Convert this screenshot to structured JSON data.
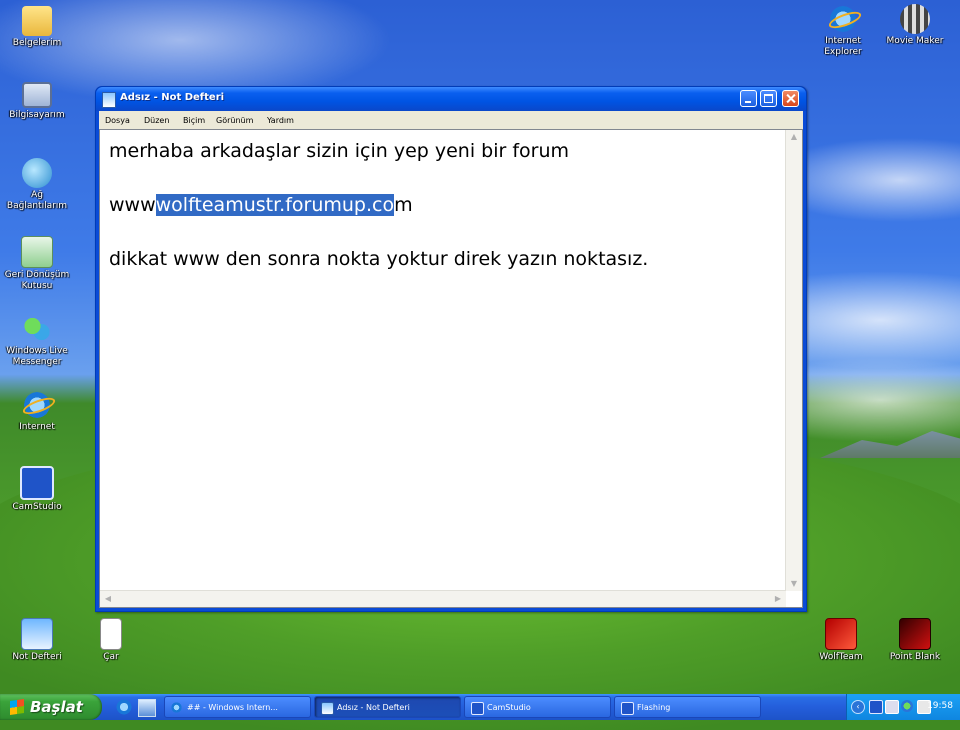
{
  "desktop": {
    "left_icons": [
      {
        "label": "Belgelerim",
        "icon": "folder-icon"
      },
      {
        "label": "Bilgisayarım",
        "icon": "computer-icon"
      },
      {
        "label": "Ağ Bağlantılarım",
        "icon": "network-icon"
      },
      {
        "label": "Geri Dönüşüm Kutusu",
        "icon": "recycle-bin-icon"
      },
      {
        "label": "Windows Live Messenger",
        "icon": "messenger-icon"
      },
      {
        "label": "Internet",
        "icon": "internet-explorer-icon"
      },
      {
        "label": "CamStudio",
        "icon": "camstudio-icon"
      }
    ],
    "bottom_left_icons": [
      {
        "label": "Not Defteri",
        "icon": "notepad-icon"
      },
      {
        "label": "Çar",
        "icon": "document-icon"
      }
    ],
    "top_right_icons": [
      {
        "label": "Internet Explorer",
        "icon": "internet-explorer-icon"
      },
      {
        "label": "Movie Maker",
        "icon": "movie-maker-icon"
      }
    ],
    "bottom_right_icons": [
      {
        "label": "WolfTeam",
        "icon": "wolfteam-icon"
      },
      {
        "label": "Point Blank",
        "icon": "point-blank-icon"
      }
    ]
  },
  "notepad": {
    "title": "Adsız - Not Defteri",
    "menu": [
      "Dosya",
      "Düzen",
      "Biçim",
      "Görünüm",
      "Yardım"
    ],
    "content": {
      "line1": "merhaba arkadaşlar sizin için yep yeni bir forum",
      "line2_prefix": "www",
      "line2_selected": "wolfteamustr.forumup.co",
      "line2_suffix": "m",
      "line3": "dikkat www den sonra nokta yoktur direk yazın noktasız."
    }
  },
  "taskbar": {
    "start_label": "Başlat",
    "tasks": [
      {
        "label": "## - Windows Intern...",
        "icon": "internet-explorer-icon",
        "active": false
      },
      {
        "label": "Adsız - Not Defteri",
        "icon": "notepad-icon",
        "active": true
      },
      {
        "label": "CamStudio",
        "icon": "camstudio-icon",
        "active": false
      },
      {
        "label": "Flashing",
        "icon": "flashing-icon",
        "active": false
      }
    ],
    "clock": "19:58"
  }
}
